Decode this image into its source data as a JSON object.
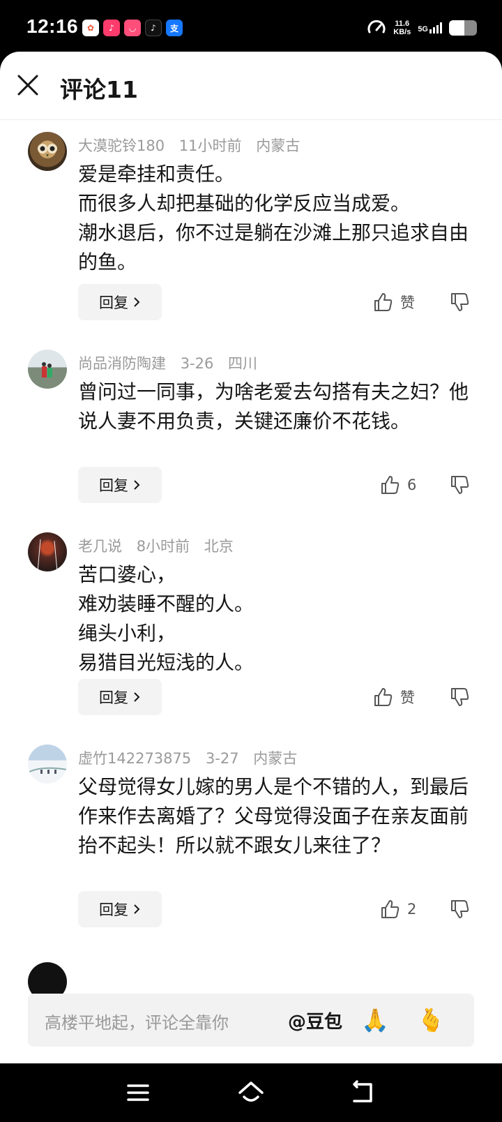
{
  "status_bar": {
    "time": "12:16",
    "app_icons": [
      "todo-app-icon",
      "douyin-red-icon",
      "video-app-icon",
      "tiktok-icon",
      "alipay-icon"
    ],
    "net_speed_value": "11.6",
    "net_speed_unit": "KB/s",
    "network": "5G",
    "battery_fraction": 0.55
  },
  "header": {
    "title": "评论11"
  },
  "comments": [
    {
      "user": "大漠驼铃180",
      "time": "11小时前",
      "location": "内蒙古",
      "text": "爱是牵挂和责任。\n而很多人却把基础的化学反应当成爱。\n潮水退后，你不过是躺在沙滩上那只追求自由的鱼。",
      "reply_label": "回复",
      "like_label": "赞"
    },
    {
      "user": "尚品消防陶建",
      "time": "3-26",
      "location": "四川",
      "text": "曾问过一同事，为啥老爱去勾搭有夫之妇？他说人妻不用负责，关键还廉价不花钱。",
      "reply_label": "回复",
      "like_label": "6"
    },
    {
      "user": "老几说",
      "time": "8小时前",
      "location": "北京",
      "text": "苦口婆心，\n难劝装睡不醒的人。\n绳头小利，\n易猎目光短浅的人。",
      "reply_label": "回复",
      "like_label": "赞"
    },
    {
      "user": "虚竹142273875",
      "time": "3-27",
      "location": "内蒙古",
      "text": "父母觉得女儿嫁的男人是个不错的人，到最后作来作去离婚了？父母觉得没面子在亲友面前抬不起头！所以就不跟女儿来往了？",
      "reply_label": "回复",
      "like_label": "2"
    }
  ],
  "input_bar": {
    "placeholder": "高楼平地起，评论全靠你",
    "mention": "@豆包",
    "emoji_1": "🙏",
    "emoji_2": "🫰"
  },
  "colors": {
    "text_primary": "#161616",
    "text_secondary": "#9a9a9a",
    "button_bg": "#f3f3f3"
  }
}
